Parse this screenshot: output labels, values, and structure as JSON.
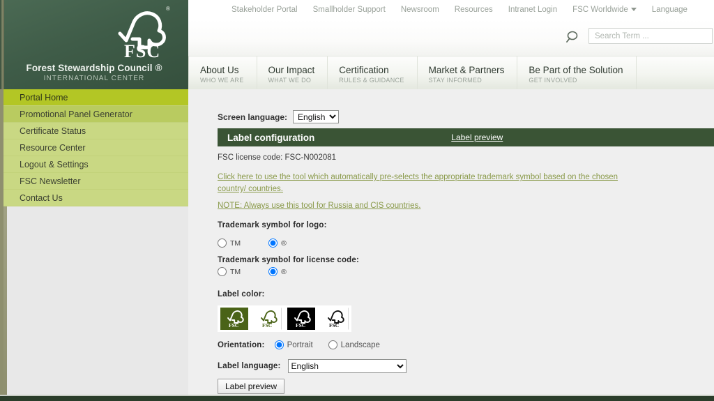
{
  "brand": {
    "logo_icon": "fsc-tree-checkmark-logo",
    "logo_text": "FSC",
    "registered_mark": "®",
    "name": "Forest Stewardship Council ®",
    "subtitle": "INTERNATIONAL CENTER",
    "color": "#3f5c48"
  },
  "topnav": {
    "items": [
      {
        "label": "Stakeholder Portal",
        "caret": false
      },
      {
        "label": "Smallholder Support",
        "caret": false
      },
      {
        "label": "Newsroom",
        "caret": false
      },
      {
        "label": "Resources",
        "caret": false
      },
      {
        "label": "Intranet Login",
        "caret": false
      },
      {
        "label": "FSC Worldwide",
        "caret": true
      },
      {
        "label": "Language",
        "caret": false
      }
    ]
  },
  "search": {
    "icon": "magnifier-icon",
    "value": "",
    "placeholder": "Search Term ..."
  },
  "mainnav": {
    "items": [
      {
        "title": "About Us",
        "subtitle": "WHO WE ARE"
      },
      {
        "title": "Our Impact",
        "subtitle": "WHAT WE DO"
      },
      {
        "title": "Certification",
        "subtitle": "RULES & GUIDANCE"
      },
      {
        "title": "Market & Partners",
        "subtitle": "STAY INFORMED"
      },
      {
        "title": "Be Part of the Solution",
        "subtitle": "GET INVOLVED"
      }
    ]
  },
  "sidebar": {
    "active_color": "#b3c625",
    "item_color": "#c9d883",
    "items": [
      {
        "label": "Portal Home",
        "state": "active"
      },
      {
        "label": "Promotional Panel Generator",
        "state": "current"
      },
      {
        "label": "Certificate Status",
        "state": "normal"
      },
      {
        "label": "Resource Center",
        "state": "normal"
      },
      {
        "label": "Logout & Settings",
        "state": "normal"
      },
      {
        "label": "FSC Newsletter",
        "state": "normal"
      },
      {
        "label": "Contact Us",
        "state": "normal"
      }
    ]
  },
  "main": {
    "screen_language": {
      "label": "Screen language:",
      "value": "English",
      "options": [
        "English"
      ]
    },
    "config_header": {
      "title": "Label configuration",
      "preview_link": "Label preview",
      "color": "#3a5435"
    },
    "license": {
      "label": "FSC license code:",
      "code": "FSC-N002081",
      "full": "FSC license code: FSC-N002081"
    },
    "links": {
      "tool_link": "Click here to use the tool which automatically pre-selects the appropriate trademark symbol based on the chosen country/ countries.",
      "note_link": "NOTE: Always use this tool for Russia and CIS countries.",
      "color": "#8a9a4a"
    },
    "trademark_logo": {
      "label": "Trademark symbol for logo:",
      "options": [
        {
          "label": "TM",
          "selected": false
        },
        {
          "label": "®",
          "selected": true
        }
      ]
    },
    "trademark_license": {
      "label": "Trademark symbol for license code:",
      "options": [
        {
          "label": "TM",
          "selected": false
        },
        {
          "label": "®",
          "selected": true
        }
      ]
    },
    "label_color": {
      "label": "Label color:",
      "swatches": [
        {
          "name": "green-background-white-logo",
          "bg": "#4a6317",
          "fg": "#ffffff",
          "selected": true
        },
        {
          "name": "white-background-green-logo",
          "bg": "#ffffff",
          "fg": "#4a6317",
          "selected": false
        },
        {
          "name": "black-background-white-logo",
          "bg": "#000000",
          "fg": "#ffffff",
          "selected": false
        },
        {
          "name": "white-background-black-logo",
          "bg": "#ffffff",
          "fg": "#000000",
          "selected": false
        }
      ]
    },
    "orientation": {
      "label": "Orientation:",
      "options": [
        {
          "label": "Portrait",
          "selected": true
        },
        {
          "label": "Landscape",
          "selected": false
        }
      ]
    },
    "label_language": {
      "label": "Label language:",
      "value": "English",
      "options": [
        "English"
      ]
    },
    "preview_button": "Label preview"
  }
}
